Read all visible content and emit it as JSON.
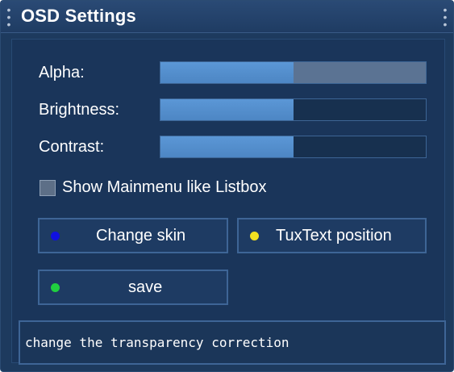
{
  "window": {
    "title": "OSD Settings"
  },
  "sliders": [
    {
      "label": "Alpha:",
      "value_fraction": 0.5,
      "style": "filled-with-light-remainder"
    },
    {
      "label": "Brightness:",
      "value_fraction": 0.5,
      "style": "filled"
    },
    {
      "label": "Contrast:",
      "value_fraction": 0.5,
      "style": "filled"
    }
  ],
  "options": {
    "show_mainmenu_label": "Show Mainmenu like Listbox",
    "show_mainmenu_checked": false
  },
  "buttons": {
    "change_skin": {
      "label": "Change skin",
      "dot_color": "#1010e0"
    },
    "tuxtext_position": {
      "label": "TuxText position",
      "dot_color": "#f2e020"
    },
    "save": {
      "label": "save",
      "dot_color": "#20d040"
    }
  },
  "status": {
    "text": "change the transparency correction"
  },
  "colors": {
    "background": "#1d3a5e",
    "slider_fill": "#5b97d6",
    "slider_remainder": "#5b7393",
    "border": "#3e6596"
  }
}
